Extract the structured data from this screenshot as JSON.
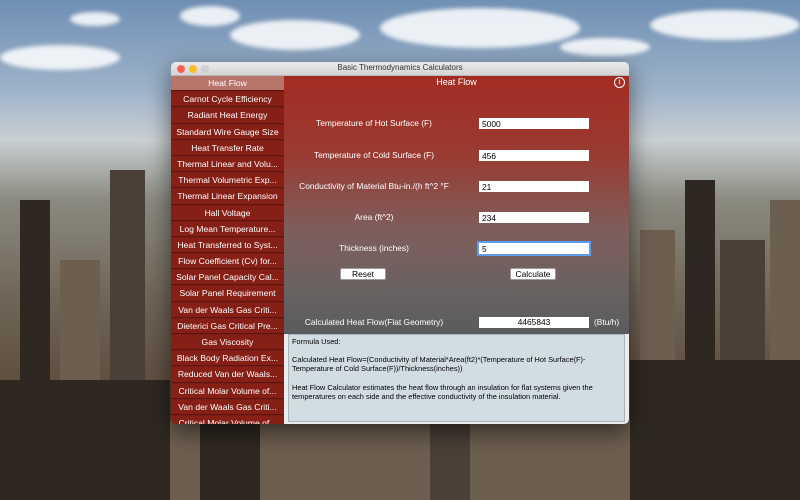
{
  "window": {
    "title": "Basic Thermodynamics Calculators"
  },
  "sidebar": {
    "items": [
      {
        "label": "Heat Flow",
        "active": true
      },
      {
        "label": "Carnot Cycle Efficiency"
      },
      {
        "label": "Radiant Heat Energy"
      },
      {
        "label": "Standard Wire Gauge Size"
      },
      {
        "label": "Heat Transfer Rate"
      },
      {
        "label": "Thermal Linear and Volu..."
      },
      {
        "label": "Thermal Volumetric Exp..."
      },
      {
        "label": "Thermal Linear Expansion"
      },
      {
        "label": "Hall Voltage"
      },
      {
        "label": "Log Mean Temperature..."
      },
      {
        "label": "Heat Transferred to Syst..."
      },
      {
        "label": "Flow Coefficient (Cv) for..."
      },
      {
        "label": "Solar Panel Capacity Cal..."
      },
      {
        "label": "Solar Panel Requirement"
      },
      {
        "label": "Van der Waals Gas Criti..."
      },
      {
        "label": "Dieterici Gas Critical Pre..."
      },
      {
        "label": "Gas Viscosity"
      },
      {
        "label": "Black Body Radiation Ex..."
      },
      {
        "label": "Reduced Van der Waals..."
      },
      {
        "label": "Critical Molar Volume of..."
      },
      {
        "label": "Van der Waals Gas Criti..."
      },
      {
        "label": "Critical Molar Volume of..."
      }
    ]
  },
  "main": {
    "title": "Heat Flow",
    "fields": {
      "hot_surface": {
        "label": "Temperature of Hot Surface (F)",
        "value": "5000"
      },
      "cold_surface": {
        "label": "Temperature of Cold Surface (F)",
        "value": "456"
      },
      "conductivity": {
        "label": "Conductivity of Material Btu-in./(h ft^2 °F",
        "value": "21"
      },
      "area": {
        "label": "Area (ft^2)",
        "value": "234"
      },
      "thickness": {
        "label": "Thickness (inches)",
        "value": "5"
      }
    },
    "reset_label": "Reset",
    "calculate_label": "Calculate",
    "result": {
      "label": "Calculated Heat Flow(Flat Geometry)",
      "value": "4465843",
      "unit": "(Btu/h)"
    }
  },
  "formula": {
    "heading": "Formula Used:",
    "text": "Calculated Heat Flow=(Conductivity of Material*Area(ft2)*(Temperature of Hot Surface(F)-Temperature of Cold Surface(F))/Thickness(inches))",
    "description": "Heat Flow Calculator estimates the heat flow through an insulation for flat systems given the temperatures on each side and the effective conductivity of the insulation material."
  },
  "icons": {
    "info": "info-icon"
  }
}
